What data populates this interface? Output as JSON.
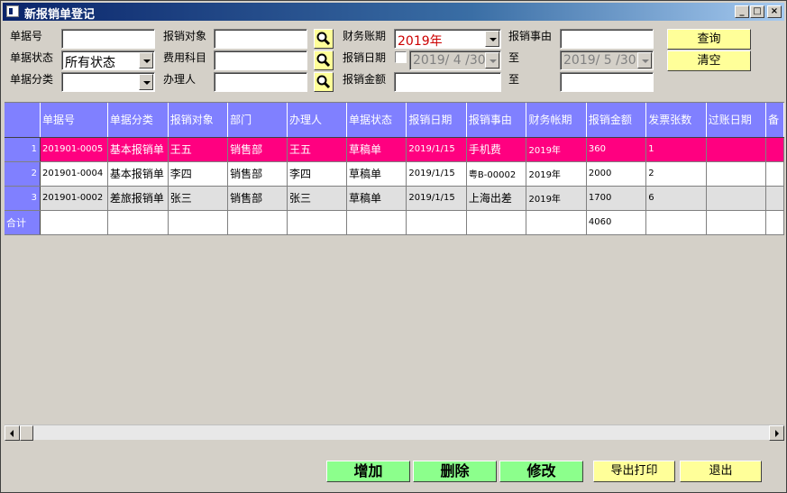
{
  "window": {
    "title": "新报销单登记"
  },
  "filters": {
    "doc_no_label": "单据号",
    "doc_no_value": "",
    "status_label": "单据状态",
    "status_value": "所有状态",
    "category_label": "单据分类",
    "category_value": "",
    "target_label": "报销对象",
    "target_value": "",
    "subject_label": "费用科目",
    "subject_value": "",
    "handler_label": "办理人",
    "handler_value": "",
    "period_label": "财务账期",
    "period_value": "2019年",
    "date_label": "报销日期",
    "date_from": "2019/ 4 /30",
    "date_to": "2019/ 5 /30",
    "amount_label": "报销金额",
    "amount_from": "",
    "amount_to": "",
    "reason_label": "报销事由",
    "reason_value": "",
    "to_label": "至",
    "to_label2": "至"
  },
  "buttons": {
    "query": "查询",
    "clear": "清空",
    "add": "增加",
    "delete": "删除",
    "modify": "修改",
    "export_print": "导出打印",
    "exit": "退出"
  },
  "table": {
    "columns": [
      "单据号",
      "单据分类",
      "报销对象",
      "部门",
      "办理人",
      "单据状态",
      "报销日期",
      "报销事由",
      "财务帐期",
      "报销金额",
      "发票张数",
      "过账日期",
      "备"
    ],
    "rows": [
      [
        "1",
        "201901-0005",
        "基本报销单",
        "王五",
        "销售部",
        "王五",
        "草稿单",
        "2019/1/15",
        "手机费",
        "2019年",
        "360",
        "1",
        "",
        ""
      ],
      [
        "2",
        "201901-0004",
        "基本报销单",
        "李四",
        "销售部",
        "李四",
        "草稿单",
        "2019/1/15",
        "粤B-00002",
        "2019年",
        "2000",
        "2",
        "",
        ""
      ],
      [
        "3",
        "201901-0002",
        "差旅报销单",
        "张三",
        "销售部",
        "张三",
        "草稿单",
        "2019/1/15",
        "上海出差",
        "2019年",
        "1700",
        "6",
        "",
        ""
      ]
    ],
    "total_label": "合计",
    "total_amount": "4060"
  },
  "colors": {
    "header_bg": "#8080ff",
    "selected_row": "#ff0080",
    "period_text": "#cc0000",
    "action_button": "#8cff8c",
    "yellow_button": "#ffff99"
  }
}
